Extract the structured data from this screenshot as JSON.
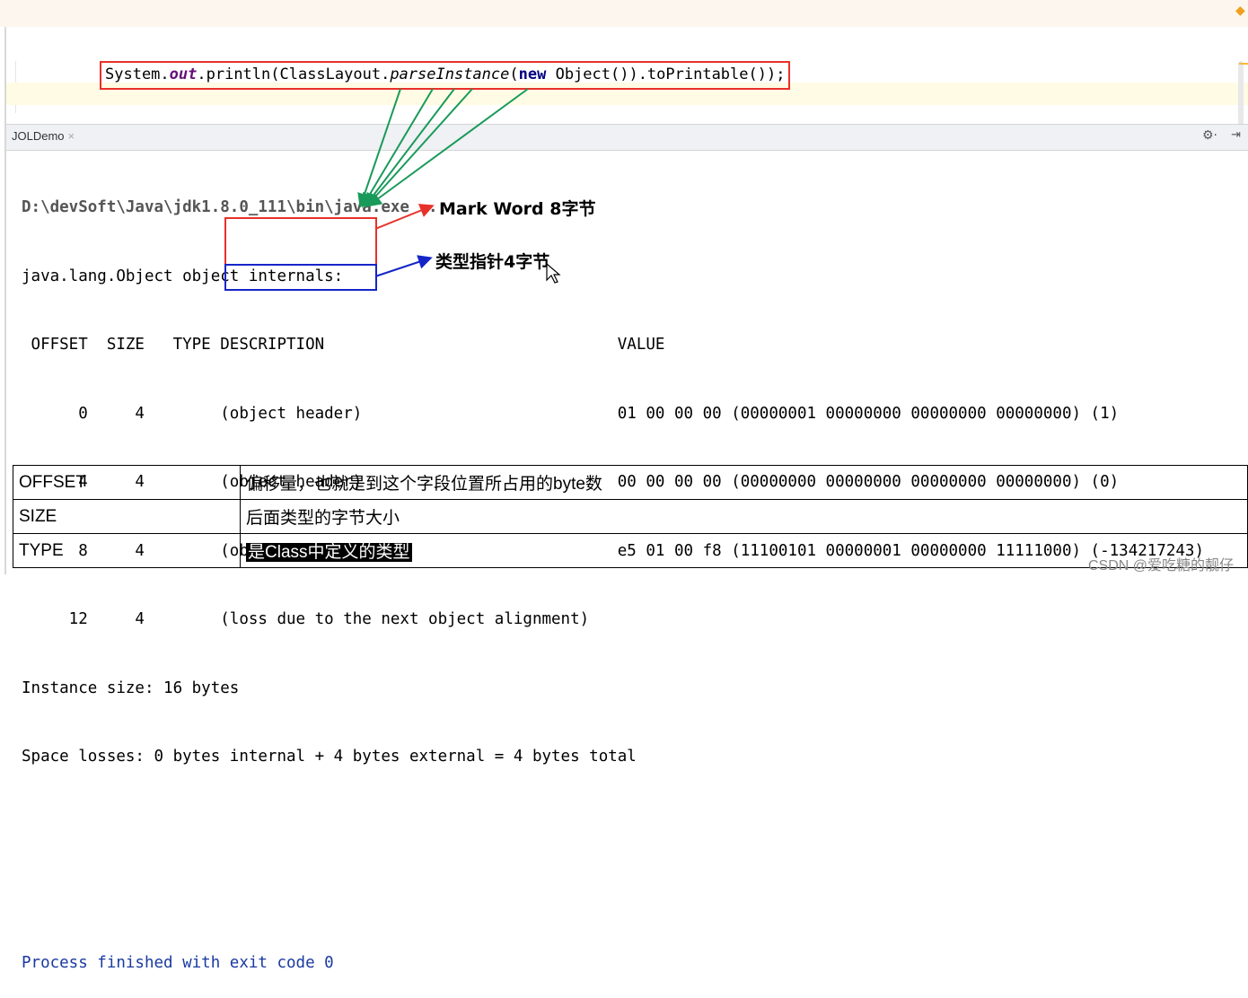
{
  "editor": {
    "code": {
      "p1": "System.",
      "field": "out",
      "p2": ".println(ClassLayout.",
      "method": "parseInstance",
      "p3": "(",
      "kw": "new",
      "p4": " Object()).toPrintable());"
    }
  },
  "run_panel": {
    "tab_label": "JOLDemo",
    "close_glyph": "×",
    "settings_glyph": "⚙·",
    "pin_glyph": "⇥"
  },
  "console": {
    "command": "D:\\devSoft\\Java\\jdk1.8.0_111\\bin\\java.exe ...",
    "header_line": "java.lang.Object object internals:",
    "columns_line": " OFFSET  SIZE   TYPE DESCRIPTION                               VALUE",
    "rows": [
      "      0     4        (object header)                           01 00 00 00 (00000001 00000000 00000000 00000000) (1)",
      "      4     4        (object header)                           00 00 00 00 (00000000 00000000 00000000 00000000) (0)",
      "      8     4        (object header)                           e5 01 00 f8 (11100101 00000001 00000000 11111000) (-134217243)",
      "     12     4        (loss due to the next object alignment)"
    ],
    "instance_size": "Instance size: 16 bytes",
    "space_losses": "Space losses: 0 bytes internal + 4 bytes external = 4 bytes total",
    "blank": "",
    "exit_line": "Process finished with exit code 0"
  },
  "annotations": {
    "mark_word": "Mark Word 8字节",
    "class_pointer": "类型指针4字节",
    "colors": {
      "red": "#e8302a",
      "blue": "#1525c8",
      "green": "#1a9a5a"
    }
  },
  "legend": {
    "rows": [
      {
        "key": "OFFSET",
        "value": "偏移量，也就是到这个字段位置所占用的byte数"
      },
      {
        "key": "SIZE",
        "value": "后面类型的字节大小"
      },
      {
        "key": "TYPE",
        "value": "是Class中定义的类型"
      }
    ]
  },
  "watermark": "CSDN @爱吃糖的靓仔"
}
